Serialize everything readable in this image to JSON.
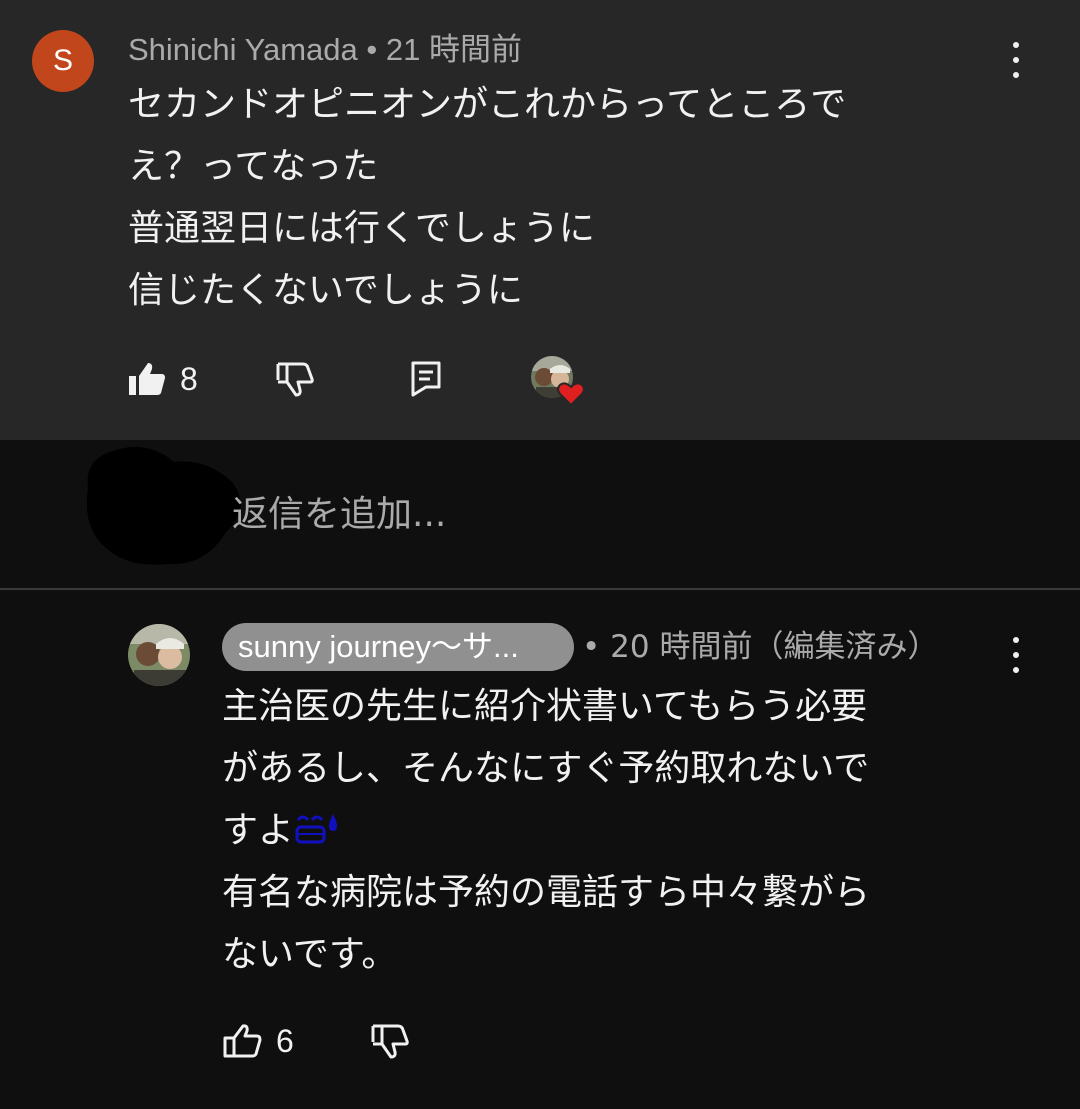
{
  "top_comment": {
    "avatar_letter": "S",
    "avatar_color": "#c2461c",
    "author": "Shinichi Yamada",
    "separator": "•",
    "time": "21 時間前",
    "lines": [
      "セカンドオピニオンがこれからってところで",
      "え？ってなった",
      "普通翌日には行くでしょうに",
      "信じたくないでしょうに"
    ],
    "like_count": "8",
    "icons": {
      "like": "thumbs-up-filled-icon",
      "dislike": "thumbs-down-icon",
      "reply": "reply-comment-icon",
      "more": "more-vert-icon",
      "hearted": "creator-heart-icon"
    }
  },
  "reply_bar": {
    "placeholder": "返信を追加..."
  },
  "reply_comment": {
    "author": "sunny journey〜サ...",
    "meta": "• 20 時間前（編集済み）",
    "lines": [
      "主治医の先生に紹介状書いてもらう必要",
      "があるし、そんなにすぐ予約取れないで",
      "すよ",
      "有名な病院は予約の電話すら中々繋がら",
      "ないです。"
    ],
    "emoji": "sweat-smile-emoji",
    "like_count": "6",
    "icons": {
      "like": "thumbs-up-outline-icon",
      "dislike": "thumbs-down-icon",
      "more": "more-vert-icon"
    }
  },
  "colors": {
    "top_comment_bg": "#272727",
    "page_bg": "#0f0f0f",
    "secondary_text": "#aaaaaa",
    "author_chip_bg": "#909090",
    "heart_red": "#e02020"
  }
}
